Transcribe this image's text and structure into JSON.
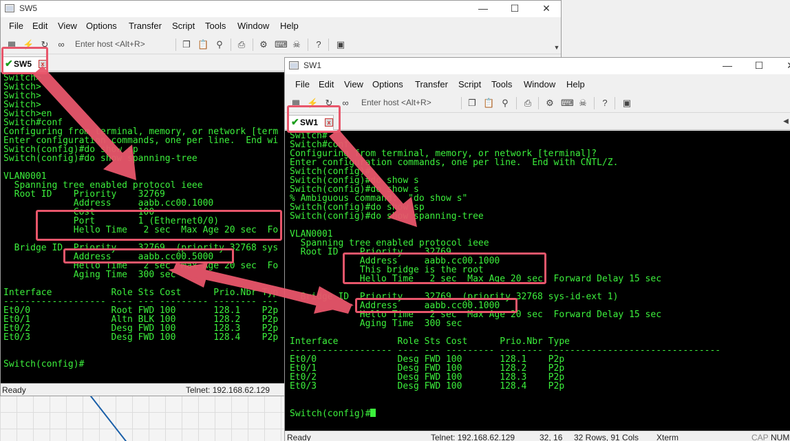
{
  "sw5": {
    "title": "SW5",
    "menu": [
      "File",
      "Edit",
      "View",
      "Options",
      "Transfer",
      "Script",
      "Tools",
      "Window",
      "Help"
    ],
    "host_placeholder": "Enter host <Alt+R>",
    "tab_label": "SW5",
    "terminal_lines": [
      "Switch>",
      "Switch>",
      "Switch>",
      "Switch>",
      "Switch>en",
      "Switch#conf",
      "Configuring from terminal, memory, or network [term",
      "Enter configuration commands, one per line.  End wi",
      "Switch(config)#do show sp",
      "Switch(config)#do show spanning-tree",
      "",
      "VLAN0001",
      "  Spanning tree enabled protocol ieee",
      "  Root ID    Priority    32769",
      "             Address     aabb.cc00.1000",
      "             Cost        100",
      "             Port        1 (Ethernet0/0)",
      "             Hello Time   2 sec  Max Age 20 sec  Fo",
      "",
      "  Bridge ID  Priority    32769  (priority 32768 sys",
      "             Address     aabb.cc00.5000",
      "             Hello Time   2 sec  Max Age 20 sec  Fo",
      "             Aging Time  300 sec",
      "",
      "Interface           Role Sts Cost      Prio.Nbr Typ",
      "------------------- ---- --- --------- -------- ---",
      "Et0/0               Root FWD 100       128.1    P2p",
      "Et0/1               Altn BLK 100       128.2    P2p",
      "Et0/2               Desg FWD 100       128.3    P2p",
      "Et0/3               Desg FWD 100       128.4    P2p",
      "",
      "",
      "Switch(config)#"
    ],
    "status_ready": "Ready",
    "status_conn": "Telnet: 192.168.62.129"
  },
  "sw1": {
    "title": "SW1",
    "menu": [
      "File",
      "Edit",
      "View",
      "Options",
      "Transfer",
      "Script",
      "Tools",
      "Window",
      "Help"
    ],
    "host_placeholder": "Enter host <Alt+R>",
    "tab_label": "SW1",
    "terminal_lines": [
      "Switch#",
      "Switch#conf",
      "Configuring from terminal, memory, or network [terminal]?",
      "Enter configuration commands, one per line.  End with CNTL/Z.",
      "Switch(config)#",
      "Switch(config)#do show s",
      "Switch(config)#do show s",
      "% Ambiguous command:  \"do show s\"",
      "Switch(config)#do show sp",
      "Switch(config)#do show spanning-tree",
      "",
      "VLAN0001",
      "  Spanning tree enabled protocol ieee",
      "  Root ID    Priority    32769",
      "             Address     aabb.cc00.1000",
      "             This bridge is the root",
      "             Hello Time   2 sec  Max Age 20 sec  Forward Delay 15 sec",
      "",
      "  Bridge ID  Priority    32769  (priority 32768 sys-id-ext 1)",
      "             Address     aabb.cc00.1000",
      "             Hello Time   2 sec  Max Age 20 sec  Forward Delay 15 sec",
      "             Aging Time  300 sec",
      "",
      "Interface           Role Sts Cost      Prio.Nbr Type",
      "------------------- ---- --- --------- -------- --------------------------------",
      "Et0/0               Desg FWD 100       128.1    P2p",
      "Et0/1               Desg FWD 100       128.2    P2p",
      "Et0/2               Desg FWD 100       128.3    P2p",
      "Et0/3               Desg FWD 100       128.4    P2p",
      "",
      "",
      "Switch(config)#"
    ],
    "status_ready": "Ready",
    "status_conn": "Telnet: 192.168.62.129",
    "status_pos": "32,  16",
    "status_size": "32 Rows, 91 Cols",
    "status_term": "Xterm",
    "status_cap": "CAP",
    "status_num": "NUM"
  },
  "icons": [
    "connect-icon",
    "lightning-icon",
    "reconnect-icon",
    "copy-icon",
    "paste-icon",
    "find-icon",
    "print-icon",
    "gear-icon",
    "keymap-icon",
    "sftp-icon",
    "help-icon",
    "screen-icon"
  ],
  "colors": {
    "terminal_bg": "#000000",
    "terminal_fg": "#3cf03c",
    "highlight": "#e8566b",
    "arrow": "#e8566b"
  }
}
